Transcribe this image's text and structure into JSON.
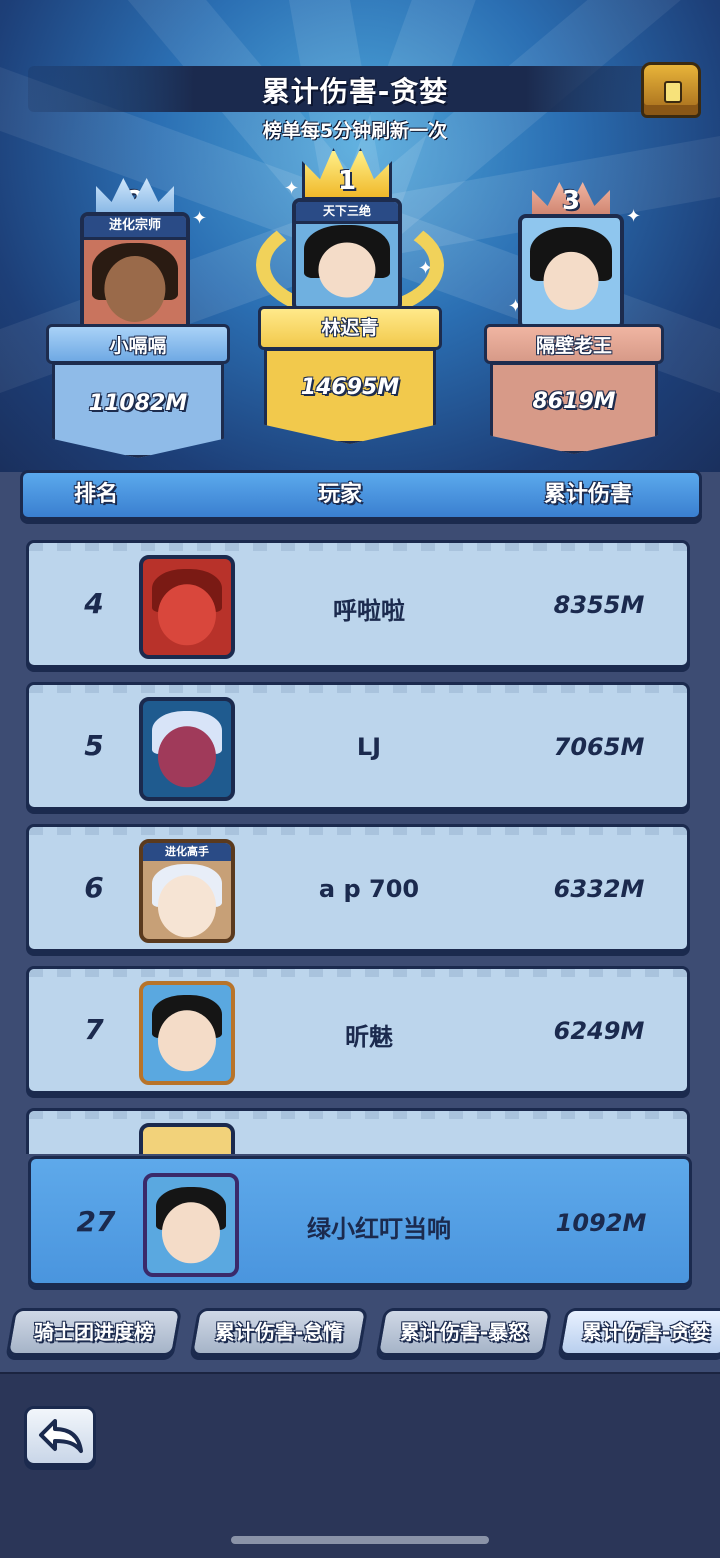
{
  "header": {
    "title": "累计伤害-贪婪",
    "subtitle": "榜单每5分钟刷新一次",
    "chest_icon": "treasure-chest-icon"
  },
  "podium": [
    {
      "rank": "2",
      "frame_label": "进化宗师",
      "name": "小嗝嗝",
      "damage": "11082M",
      "color": "#8fbbe8"
    },
    {
      "rank": "1",
      "frame_label": "天下三绝",
      "name": "林迟青",
      "damage": "14695M",
      "color": "#f2c94c"
    },
    {
      "rank": "3",
      "frame_label": "",
      "name": "隔壁老王",
      "damage": "8619M",
      "color": "#d79a88"
    }
  ],
  "table": {
    "headers": {
      "rank": "排名",
      "player": "玩家",
      "damage": "累计伤害"
    },
    "rows": [
      {
        "rank": "4",
        "name": "呼啦啦",
        "damage": "8355M",
        "avatar": "red-demon-avatar"
      },
      {
        "rank": "5",
        "name": "LJ",
        "damage": "7065M",
        "avatar": "white-hair-ninja-avatar"
      },
      {
        "rank": "6",
        "name": "a p 700",
        "damage": "6332M",
        "avatar": "white-fox-girl-avatar",
        "frame_label": "进化高手"
      },
      {
        "rank": "7",
        "name": "昕魅",
        "damage": "6249M",
        "avatar": "black-hair-girl-avatar"
      }
    ],
    "self_row": {
      "rank": "27",
      "name": "绿小红叮当响",
      "damage": "1092M",
      "avatar": "black-hair-girl-avatar"
    }
  },
  "tabs": [
    {
      "label": "骑士团进度榜",
      "active": false
    },
    {
      "label": "累计伤害-怠惰",
      "active": false
    },
    {
      "label": "累计伤害-暴怒",
      "active": false
    },
    {
      "label": "累计伤害-贪婪",
      "active": true
    }
  ],
  "footer": {
    "back_icon": "back-arrow-icon"
  }
}
